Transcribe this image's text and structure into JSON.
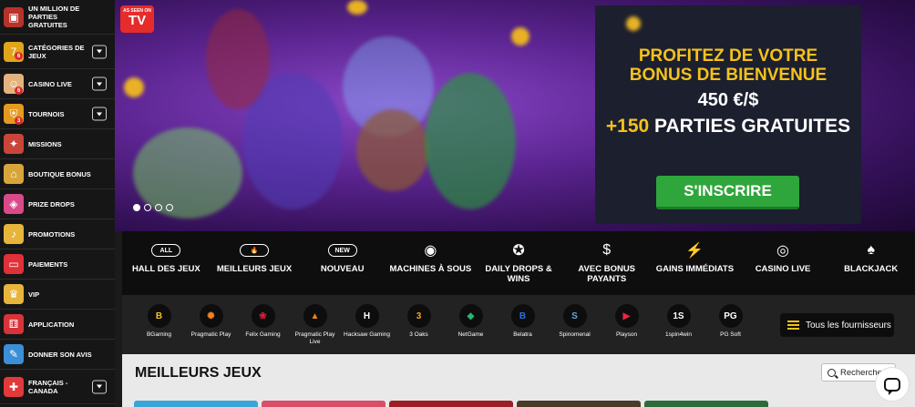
{
  "sidebar": {
    "items": [
      {
        "label": "UN MILLION DE PARTIES GRATUITES",
        "icon": "treasure-chest-icon",
        "badge": "",
        "toggle": false
      },
      {
        "label": "CATÉGORIES DE JEUX",
        "icon": "slot-777-icon",
        "badge": "6",
        "toggle": true
      },
      {
        "label": "CASINO LIVE",
        "icon": "dealer-icon",
        "badge": "6",
        "toggle": true
      },
      {
        "label": "TOURNOIS",
        "icon": "shield-icon",
        "badge": "3",
        "toggle": true
      },
      {
        "label": "MISSIONS",
        "icon": "missions-icon",
        "badge": "",
        "toggle": false
      },
      {
        "label": "BOUTIQUE BONUS",
        "icon": "shop-icon",
        "badge": "",
        "toggle": false
      },
      {
        "label": "PRIZE DROPS",
        "icon": "prize-drops-icon",
        "badge": "",
        "toggle": false
      },
      {
        "label": "PROMOTIONS",
        "icon": "bell-icon",
        "badge": "",
        "toggle": false
      },
      {
        "label": "PAIEMENTS",
        "icon": "card-icon",
        "badge": "",
        "toggle": false
      },
      {
        "label": "VIP",
        "icon": "crown-icon",
        "badge": "",
        "toggle": false
      },
      {
        "label": "APPLICATION",
        "icon": "dice-icon",
        "badge": "",
        "toggle": false
      },
      {
        "label": "DONNER SON AVIS",
        "icon": "feedback-icon",
        "badge": "",
        "toggle": false
      },
      {
        "label": "FRANÇAIS - CANADA",
        "icon": "canada-flag-icon",
        "badge": "",
        "toggle": true
      }
    ]
  },
  "banner": {
    "tv_small": "AS SEEN ON",
    "tv_big": "TV",
    "promo_line1": "PROFITEZ DE VOTRE",
    "promo_line2": "BONUS DE BIENVENUE",
    "promo_line3": "450 €/$",
    "promo_plus": "+150",
    "promo_line4": " PARTIES GRATUITES",
    "signup_label": "S'INSCRIRE",
    "slide_count": 4,
    "active_slide": 1
  },
  "categories": [
    {
      "label": "HALL DES JEUX",
      "icon": "all-icon"
    },
    {
      "label": "MEILLEURS JEUX",
      "icon": "flame-icon"
    },
    {
      "label": "NOUVEAU",
      "icon": "new-icon"
    },
    {
      "label": "MACHINES À SOUS",
      "icon": "slot-machine-icon"
    },
    {
      "label": "DAILY DROPS & WINS",
      "icon": "drops-wins-icon"
    },
    {
      "label": "AVEC BONUS PAYANTS",
      "icon": "money-bag-icon"
    },
    {
      "label": "GAINS IMMÉDIATS",
      "icon": "lightning-icon"
    },
    {
      "label": "CASINO LIVE",
      "icon": "roulette-icon"
    },
    {
      "label": "BLACKJACK",
      "icon": "cards-icon"
    }
  ],
  "providers": [
    {
      "name": "BGaming",
      "logo": "B",
      "color": "#f5c21b"
    },
    {
      "name": "Pragmatic Play",
      "logo": "✺",
      "color": "#f0821e"
    },
    {
      "name": "Felix Gaming",
      "logo": "❀",
      "color": "#d2233c"
    },
    {
      "name": "Pragmatic Play Live",
      "logo": "▲",
      "color": "#f0821e"
    },
    {
      "name": "Hacksaw Gaming",
      "logo": "H",
      "color": "#ffffff"
    },
    {
      "name": "3 Oaks",
      "logo": "3",
      "color": "#f5a623"
    },
    {
      "name": "NetGame",
      "logo": "◆",
      "color": "#26b573"
    },
    {
      "name": "Belatra",
      "logo": "B",
      "color": "#2d6fe0"
    },
    {
      "name": "Spinomenal",
      "logo": "S",
      "color": "#5aa8e6"
    },
    {
      "name": "Playson",
      "logo": "▶",
      "color": "#e8283c"
    },
    {
      "name": "1spin4win",
      "logo": "1S",
      "color": "#ffffff"
    },
    {
      "name": "PG Soft",
      "logo": "PG",
      "color": "#ffffff"
    }
  ],
  "all_providers_label": "Tous les fournisseurs",
  "games": {
    "title": "MEILLEURS JEUX",
    "search_placeholder": "Rechercher"
  }
}
